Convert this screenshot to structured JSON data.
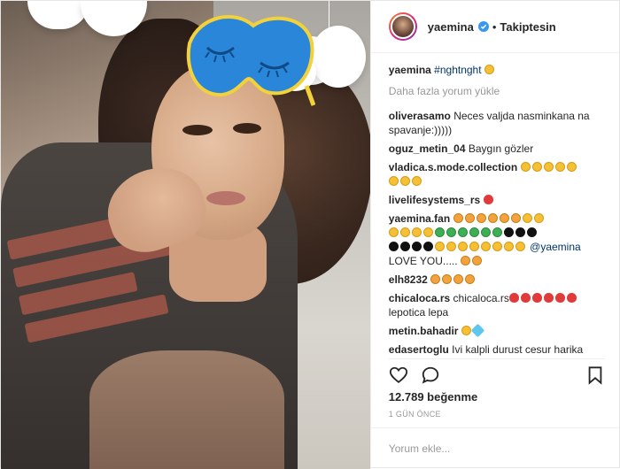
{
  "header": {
    "username": "yaemina",
    "separator": "•",
    "follow_label": "Takiptesin"
  },
  "caption": {
    "username": "yaemina",
    "hashtag": "#nghtnght"
  },
  "load_more": "Daha fazla yorum yükle",
  "comments": [
    {
      "user": "oliverasamo",
      "text": "Neces valjda nasminkana na spavanje:)))))"
    },
    {
      "user": "oguz_metin_04",
      "text": "Baygın gözler"
    },
    {
      "user": "vladica.s.mode.collection",
      "text": ""
    },
    {
      "user": "livelifesystems_rs",
      "text": ""
    },
    {
      "user": "yaemina.fan",
      "text": "",
      "mention": "@yaemina",
      "tail": "LOVE YOU....."
    },
    {
      "user": "elh8232",
      "text": ""
    },
    {
      "user": "chicaloca.rs",
      "text": "chicaloca.rs",
      "tail": "lepotica lepa"
    },
    {
      "user": "metin.bahadir",
      "text": ""
    },
    {
      "user": "edasertoglu",
      "text": "Ivi kalpli durust cesur harika"
    }
  ],
  "likes": "12.789 beğenme",
  "timestamp": "1 GÜN ÖNCE",
  "comment_input": {
    "placeholder": "Yorum ekle..."
  },
  "icons": {
    "like": "heart-icon",
    "comment": "comment-bubble-icon",
    "save": "bookmark-icon",
    "verified": "verified-badge-icon"
  },
  "colors": {
    "text": "#262626",
    "muted": "#999999",
    "hashtag": "#003569",
    "verified": "#3897f0",
    "border": "#efefef"
  }
}
